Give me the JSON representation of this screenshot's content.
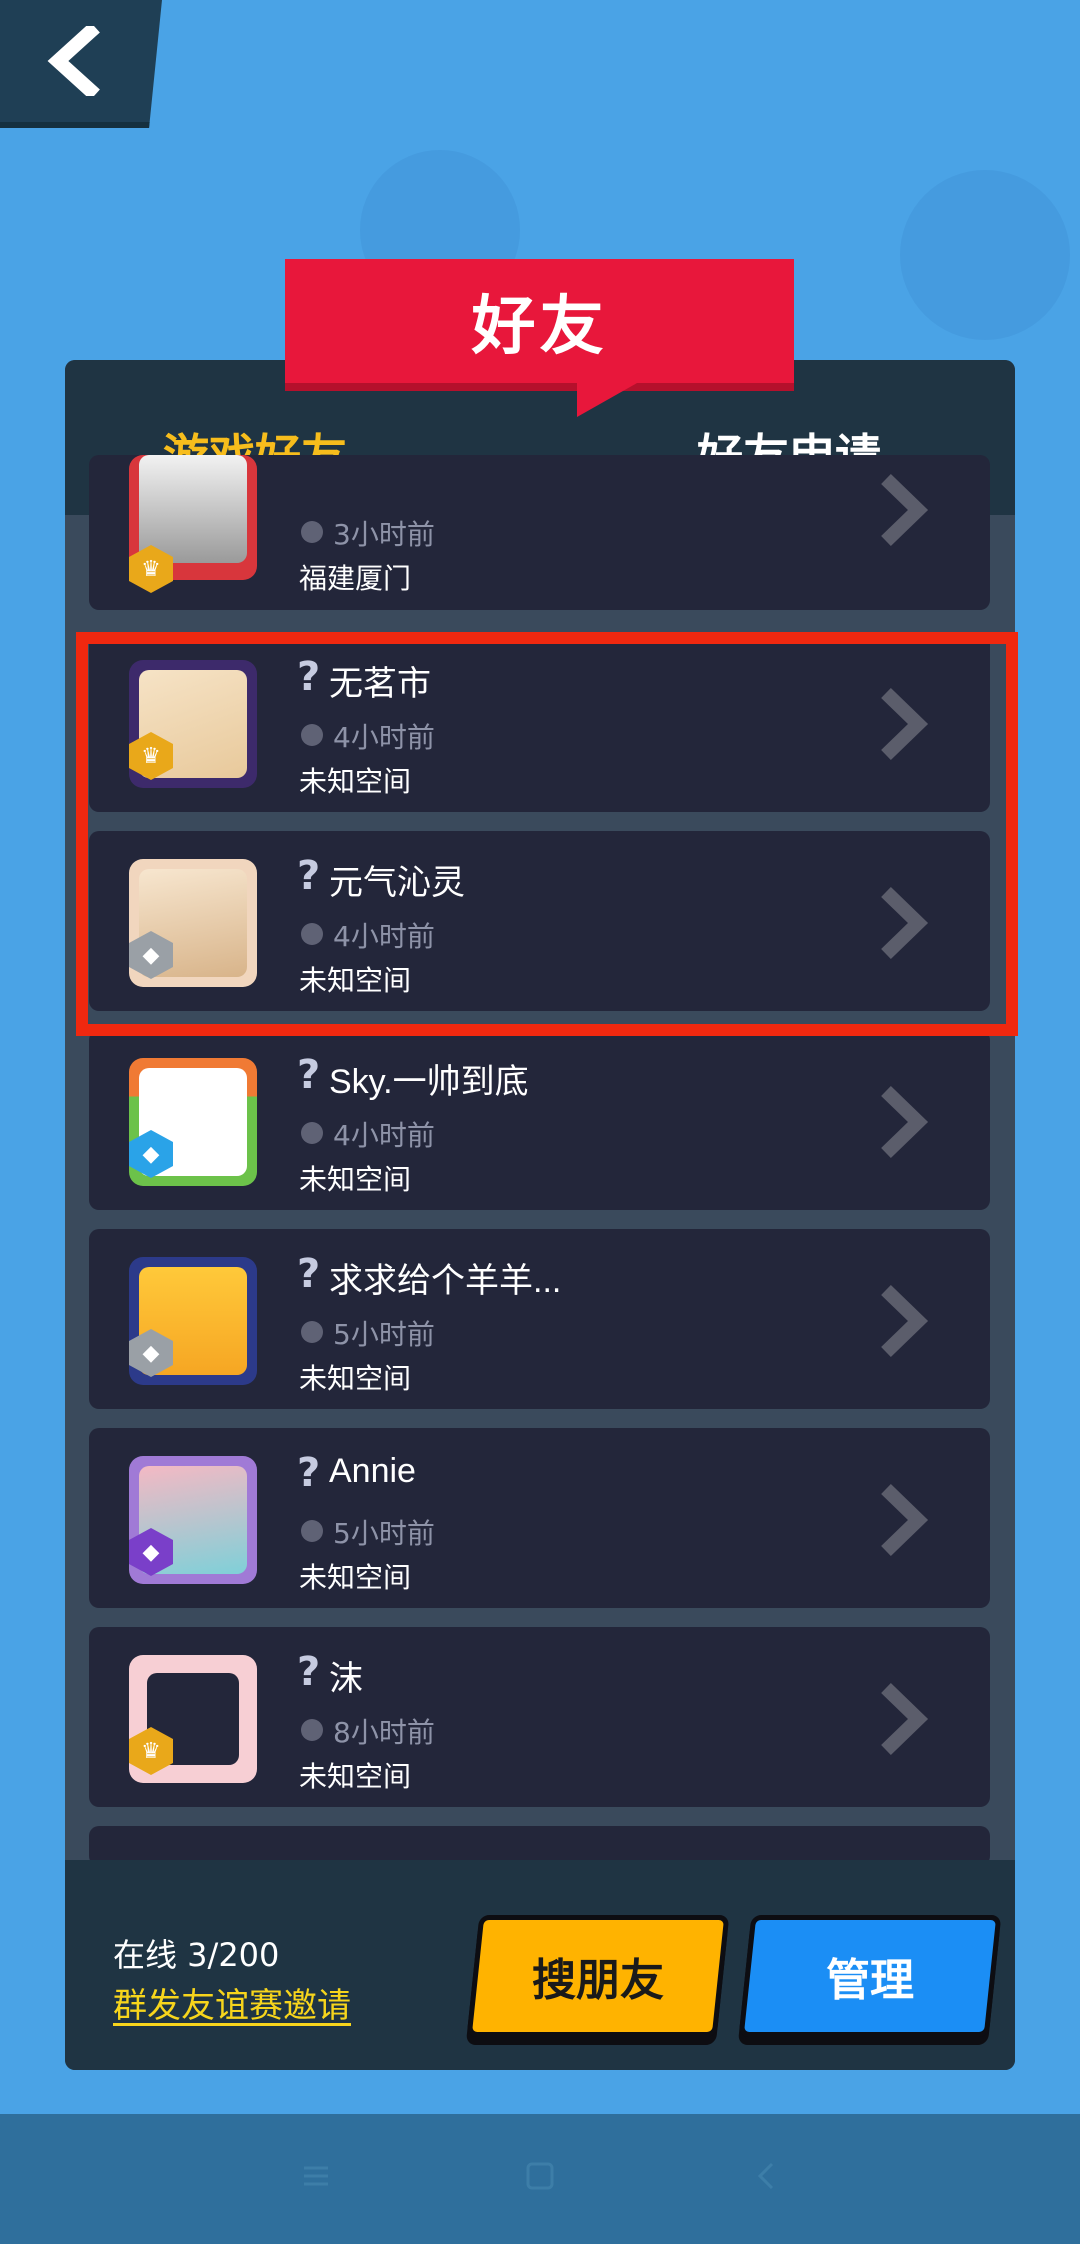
{
  "header": {
    "back_icon": "chevron-left-icon",
    "title": "好友"
  },
  "tabs": [
    {
      "label": "游戏好友",
      "active": true
    },
    {
      "label": "好友申请",
      "active": false
    }
  ],
  "friends": [
    {
      "name": "",
      "time": "3小时前",
      "location": "福建厦门",
      "badge_color": "#e9a81a",
      "badge_icon": "crown-icon"
    },
    {
      "name": "无茗市",
      "time": "4小时前",
      "location": "未知空间",
      "badge_color": "#e9a81a",
      "badge_icon": "crown-icon"
    },
    {
      "name": "元气沁灵",
      "time": "4小时前",
      "location": "未知空间",
      "badge_color": "#9aa0a6",
      "badge_icon": "rank-icon"
    },
    {
      "name": "Sky.一帅到底",
      "time": "4小时前",
      "location": "未知空间",
      "badge_color": "#2aa3e8",
      "badge_icon": "diamond-icon"
    },
    {
      "name": "求求给个羊羊...",
      "time": "5小时前",
      "location": "未知空间",
      "badge_color": "#9aa0a6",
      "badge_icon": "rank-icon"
    },
    {
      "name": "Annie",
      "time": "5小时前",
      "location": "未知空间",
      "badge_color": "#7a3fc9",
      "badge_icon": "rank-icon"
    },
    {
      "name": "沫",
      "time": "8小时前",
      "location": "未知空间",
      "badge_color": "#e9a81a",
      "badge_icon": "crown-icon"
    }
  ],
  "footer": {
    "online_label": "在线 3/200",
    "invite_link": "群发友谊赛邀请",
    "search_button": "搜朋友",
    "manage_button": "管理"
  },
  "colors": {
    "accent_yellow": "#f7bd1c",
    "banner_red": "#e8173b",
    "highlight_red": "#f0280f",
    "manage_blue": "#1b8ef5"
  }
}
